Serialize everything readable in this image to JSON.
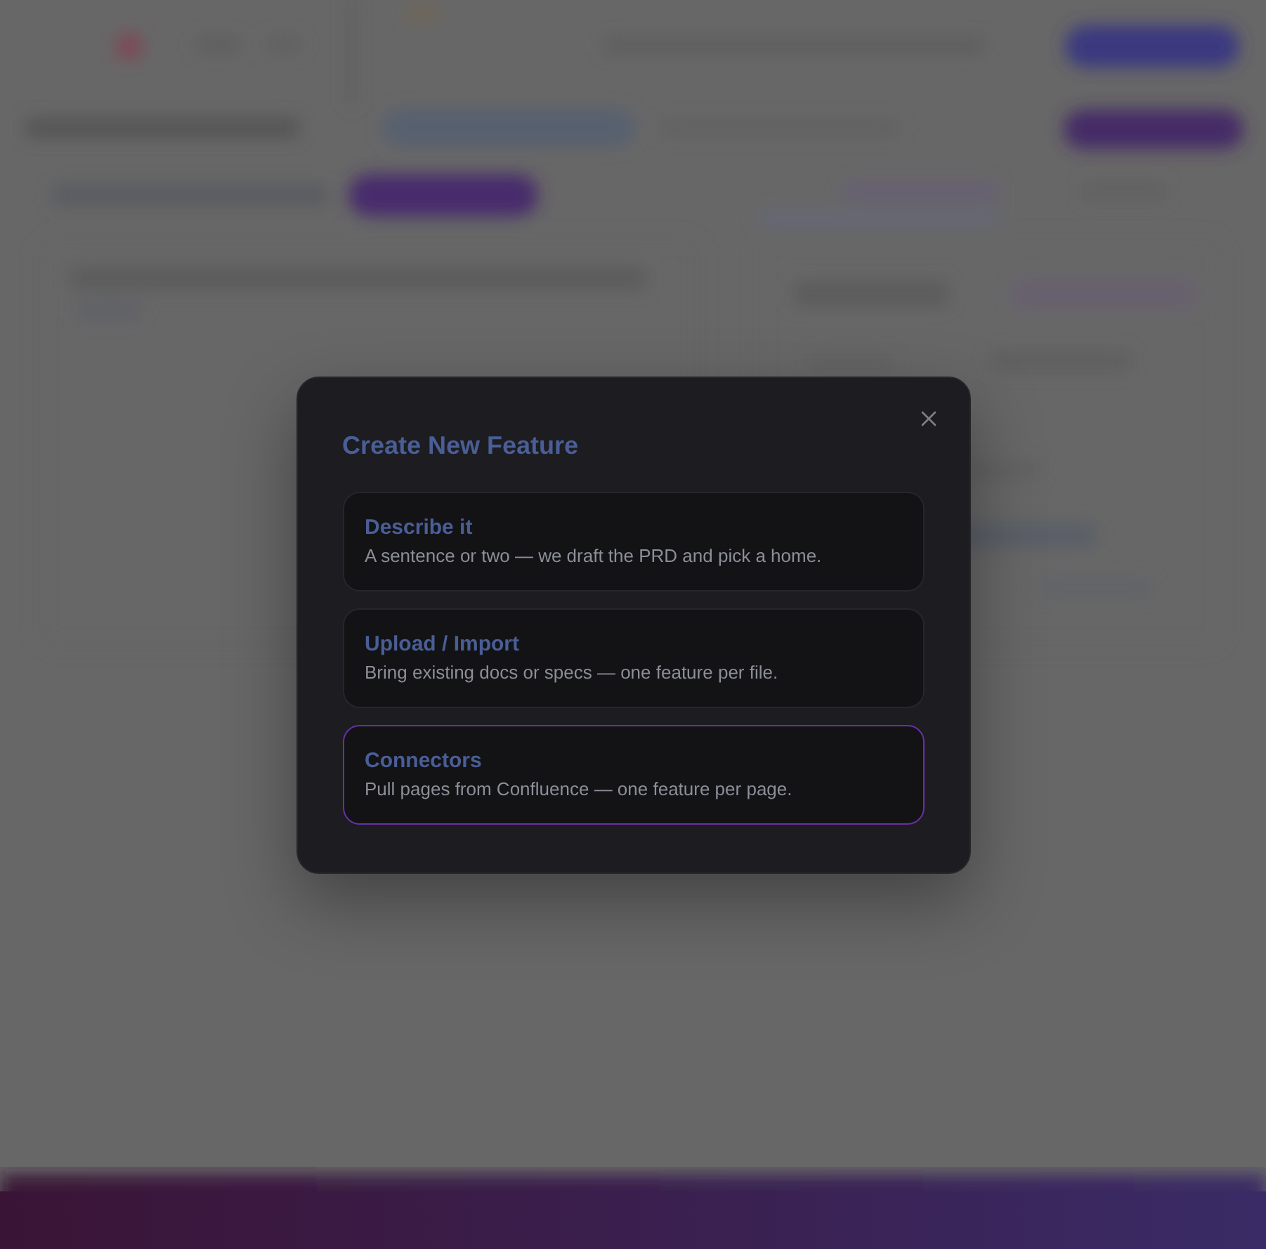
{
  "dialog": {
    "title": "Create New Feature"
  },
  "options": [
    {
      "title": "Describe it",
      "description": "A sentence or two — we draft the PRD and pick a home.",
      "selected": false
    },
    {
      "title": "Upload / Import",
      "description": "Bring existing docs or specs — one feature per file.",
      "selected": false
    },
    {
      "title": "Connectors",
      "description": "Pull pages from Confluence — one feature per page.",
      "selected": true
    }
  ]
}
